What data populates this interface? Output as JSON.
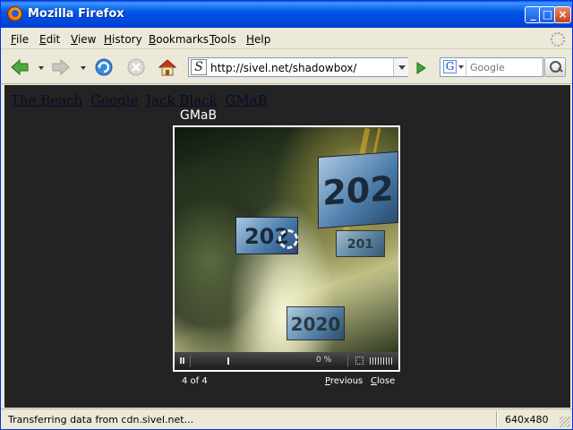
{
  "window": {
    "title": "Mozilla Firefox"
  },
  "menu": [
    "File",
    "Edit",
    "View",
    "History",
    "Bookmarks",
    "Tools",
    "Help"
  ],
  "nav": {
    "url": "http://sivel.net/shadowbox/"
  },
  "search": {
    "placeholder": "Google",
    "engine": "G"
  },
  "page": {
    "links": [
      "The Beach",
      "Google",
      "Jack Black",
      "GMaB"
    ],
    "shadowbox": {
      "title": "GMaB",
      "counter": "4 of 4",
      "previous": "Previous",
      "close": "Close",
      "progress": "0 %",
      "tile_texts": [
        "202",
        "202",
        "201",
        "2020"
      ]
    }
  },
  "status": {
    "text": "Transferring data from cdn.sivel.net...",
    "resolution": "640x480"
  }
}
